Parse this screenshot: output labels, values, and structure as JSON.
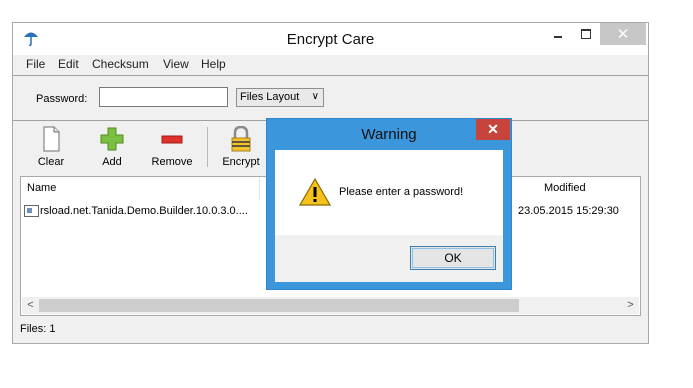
{
  "window": {
    "title": "Encrypt Care",
    "icon": "umbrella-icon",
    "minimize_icon": "minimize-icon",
    "maximize_icon": "maximize-icon",
    "close_glyph": "✕"
  },
  "menu": [
    "File",
    "Edit",
    "Checksum",
    "View",
    "Help"
  ],
  "password": {
    "label": "Password:",
    "value": "",
    "placeholder": ""
  },
  "layout_select": {
    "value": "Files Layout",
    "arrow": "∨"
  },
  "toolbar": [
    {
      "label": "Clear",
      "icon": "blank-page-icon"
    },
    {
      "label": "Add",
      "icon": "green-plus-icon"
    },
    {
      "label": "Remove",
      "icon": "red-minus-icon"
    },
    {
      "label": "Encrypt",
      "icon": "padlock-icon"
    }
  ],
  "list": {
    "columns": [
      "Name",
      "Modified"
    ],
    "rows": [
      {
        "name": "rsload.net.Tanida.Demo.Builder.10.0.3.0....",
        "modified": "23.05.2015 15:29:30"
      }
    ],
    "scroll_left": "<",
    "scroll_right": ">"
  },
  "status": "Files: 1",
  "dialog": {
    "title": "Warning",
    "close_glyph": "✕",
    "icon": "warning-icon",
    "message": "Please enter a password!",
    "button": "OK"
  },
  "colors": {
    "dialog_frame": "#3c96dc",
    "dialog_close": "#c7443c",
    "window_close": "#c7c7c7",
    "window_bg": "#f0f0f0"
  }
}
